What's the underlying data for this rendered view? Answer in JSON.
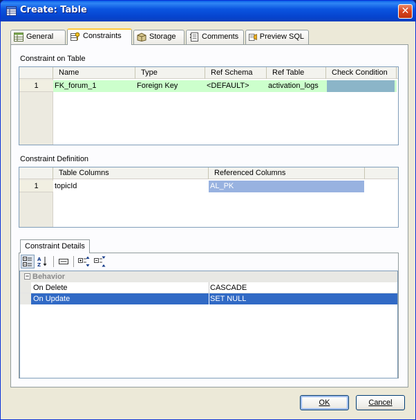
{
  "window": {
    "title": "Create: Table",
    "close_symbol": "✕"
  },
  "tabs": [
    {
      "label": "General",
      "icon": "table-grid-icon"
    },
    {
      "label": "Constraints",
      "icon": "constraint-key-icon",
      "active": true
    },
    {
      "label": "Storage",
      "icon": "storage-icon"
    },
    {
      "label": "Comments",
      "icon": "comments-icon"
    },
    {
      "label": "Preview SQL",
      "icon": "preview-sql-icon"
    }
  ],
  "constraint_on_table": {
    "label": "Constraint on Table",
    "columns": [
      "Name",
      "Type",
      "Ref Schema",
      "Ref Table",
      "Check Condition"
    ],
    "rows": [
      {
        "num": "1",
        "name": "FK_forum_1",
        "type": "Foreign Key",
        "ref_schema": "<DEFAULT>",
        "ref_table": "activation_logs",
        "check_condition": ""
      }
    ]
  },
  "constraint_definition": {
    "label": "Constraint Definition",
    "columns": [
      "Table Columns",
      "Referenced Columns"
    ],
    "rows": [
      {
        "num": "1",
        "table_column": "topicId",
        "referenced_column": "AL_PK"
      }
    ]
  },
  "constraint_details": {
    "tab_label": "Constraint Details",
    "toolbar": [
      "categorized-view-icon",
      "sort-alphabetical-icon",
      "property-pages-icon",
      "expand-all-icon",
      "collapse-all-icon"
    ],
    "category": {
      "label": "Behavior",
      "toggle": "−"
    },
    "properties": [
      {
        "name": "On Delete",
        "value": "CASCADE"
      },
      {
        "name": "On Update",
        "value": "SET NULL",
        "selected": true
      }
    ]
  },
  "buttons": {
    "ok": "OK",
    "cancel": "Cancel"
  },
  "colors": {
    "row_highlight": "#ccffcc",
    "cell_selected": "#98b2e0",
    "check_cell": "#8bb5c8",
    "selection": "#316ac5"
  }
}
